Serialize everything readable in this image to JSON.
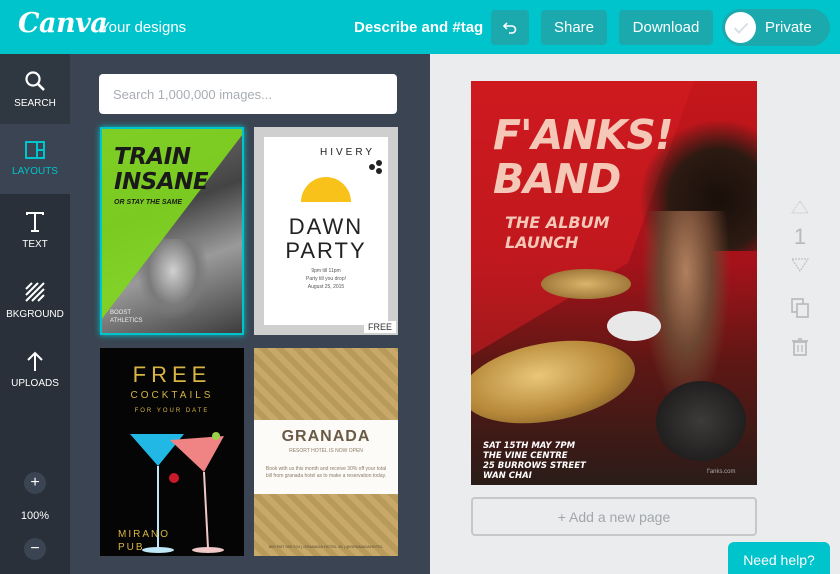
{
  "header": {
    "logo": "Canva",
    "your_designs": "Your designs",
    "describe_tag": "Describe and #tag",
    "undo_icon": "undo-icon",
    "share_label": "Share",
    "download_label": "Download",
    "private_label": "Private"
  },
  "sidebar": {
    "items": [
      {
        "label": "SEARCH",
        "icon": "search-icon"
      },
      {
        "label": "LAYOUTS",
        "icon": "layouts-icon"
      },
      {
        "label": "TEXT",
        "icon": "text-icon"
      },
      {
        "label": "BKGROUND",
        "icon": "background-icon"
      },
      {
        "label": "UPLOADS",
        "icon": "upload-icon"
      }
    ],
    "zoom_plus": "+",
    "zoom_value": "100%",
    "zoom_minus": "−"
  },
  "panel": {
    "search_placeholder": "Search 1,000,000 images...",
    "layouts": [
      {
        "headline": "TRAIN\nINSANE",
        "sub": "OR STAY THE SAME",
        "brand": "BOOST\nATHLETICS"
      },
      {
        "brand": "HIVERY",
        "headline": "DAWN\nPARTY",
        "details": "9pm till 11pm\nParty till you drop!\nAugust 25, 2015",
        "badge": "FREE"
      },
      {
        "headline": "FREE",
        "sub": "COCKTAILS",
        "sub2": "FOR YOUR DATE",
        "footer": "MIRANO\nPUB"
      },
      {
        "headline": "GRANADA",
        "sub": "RESORT HOTEL IS NOW OPEN",
        "body": "Book with us this month and receive 30% off your total bill from granada hotel as to make a reservation today.",
        "footer": "809 PBT 909 224 | GRANADA HOTEL 45 | @GRANADAHOTEL"
      }
    ]
  },
  "canvas": {
    "title": "F'ANKS!\nBAND",
    "subtitle": "THE ALBUM\nLAUNCH",
    "info": "SAT 15TH MAY 7PM\nTHE VINE CENTRE\n25 BURROWS STREET\nWAN CHAI",
    "credit": "f'anks.com",
    "page_number": "1",
    "add_page": "+ Add a new page"
  },
  "help": {
    "label": "Need help?"
  },
  "colors": {
    "accent": "#00c4cc",
    "nav_bg": "#293039",
    "panel_bg": "#3a4452"
  }
}
